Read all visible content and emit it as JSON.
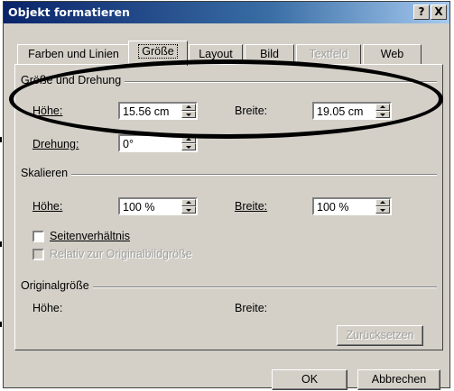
{
  "window": {
    "title": "Objekt formatieren",
    "help_btn": "?",
    "close_btn": "X"
  },
  "tabs": [
    {
      "label": "Farben und Linien",
      "state": "normal"
    },
    {
      "label": "Größe",
      "state": "active"
    },
    {
      "label": "Layout",
      "state": "normal"
    },
    {
      "label": "Bild",
      "state": "normal"
    },
    {
      "label": "Textfeld",
      "state": "disabled"
    },
    {
      "label": "Web",
      "state": "normal"
    }
  ],
  "groups": {
    "size_rotation": {
      "title": "Größe und Drehung",
      "height_label": "Höhe:",
      "height_value": "15.56 cm",
      "width_label": "Breite:",
      "width_value": "19.05 cm",
      "rotation_label": "Drehung:",
      "rotation_value": "0°"
    },
    "scale": {
      "title": "Skalieren",
      "height_label": "Höhe:",
      "height_value": "100 %",
      "width_label": "Breite:",
      "width_value": "100 %",
      "aspect_label": "Seitenverhältnis",
      "relative_label": "Relativ zur Originalbildgröße"
    },
    "original": {
      "title": "Originalgröße",
      "height_label": "Höhe:",
      "width_label": "Breite:",
      "reset_label": "Zurücksetzen"
    }
  },
  "footer": {
    "ok_label": "OK",
    "cancel_label": "Abbrechen"
  },
  "colors": {
    "dialog_bg": "#d4d0c8",
    "title_gradient_start": "#0a246a",
    "annotation_oval": "#000000"
  }
}
